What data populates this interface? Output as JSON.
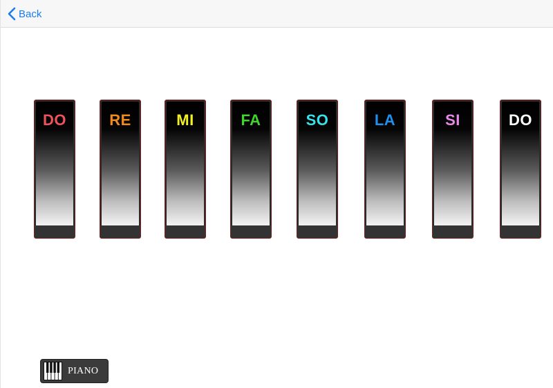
{
  "navbar": {
    "back_label": "Back",
    "accent_color": "#1a7cf0"
  },
  "keys": [
    {
      "label": "DO",
      "color": "#f0525a"
    },
    {
      "label": "RE",
      "color": "#f08a1c"
    },
    {
      "label": "MI",
      "color": "#f3f020"
    },
    {
      "label": "FA",
      "color": "#3ed62a"
    },
    {
      "label": "SO",
      "color": "#38e0e8"
    },
    {
      "label": "LA",
      "color": "#1e90f0"
    },
    {
      "label": "SI",
      "color": "#e889e8"
    },
    {
      "label": "DO",
      "color": "#ffffff"
    }
  ],
  "footer": {
    "piano_label": "PIANO",
    "icon": "piano-keys-icon"
  }
}
